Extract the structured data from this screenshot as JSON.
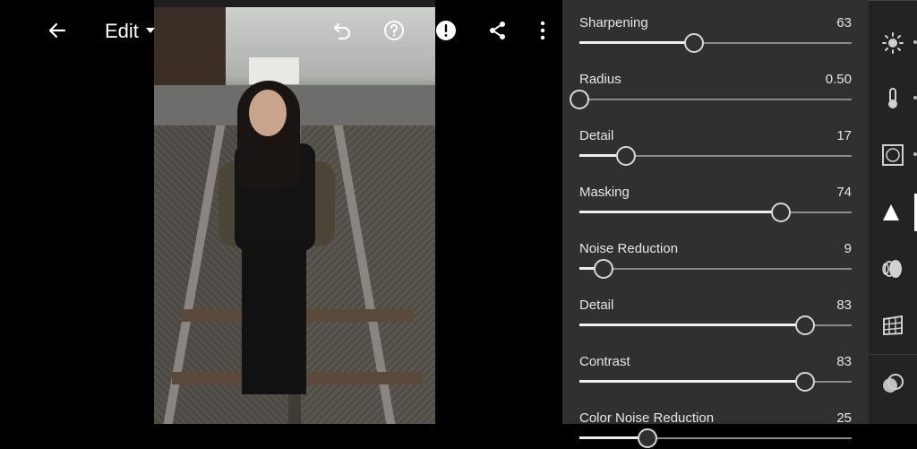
{
  "header": {
    "mode_label": "Edit"
  },
  "detail_panel": {
    "sliders": [
      {
        "label": "Sharpening",
        "value": "63",
        "fraction": 0.42
      },
      {
        "label": "Radius",
        "value": "0.50",
        "fraction": 0.0
      },
      {
        "label": "Detail",
        "value": "17",
        "fraction": 0.17
      },
      {
        "label": "Masking",
        "value": "74",
        "fraction": 0.74
      },
      {
        "label": "Noise Reduction",
        "value": "9",
        "fraction": 0.09
      },
      {
        "label": "Detail",
        "value": "83",
        "fraction": 0.83
      },
      {
        "label": "Contrast",
        "value": "83",
        "fraction": 0.83
      },
      {
        "label": "Color Noise Reduction",
        "value": "25",
        "fraction": 0.25
      }
    ]
  },
  "toolbar": {
    "tools": [
      "light-icon",
      "color-icon",
      "effects-icon",
      "detail-icon",
      "optics-icon",
      "geometry-icon",
      "mixer-icon"
    ],
    "active": "detail-icon"
  },
  "colors": {
    "panel_bg": "#303030",
    "toolbar_bg": "#232323",
    "accent": "#ffffff"
  }
}
